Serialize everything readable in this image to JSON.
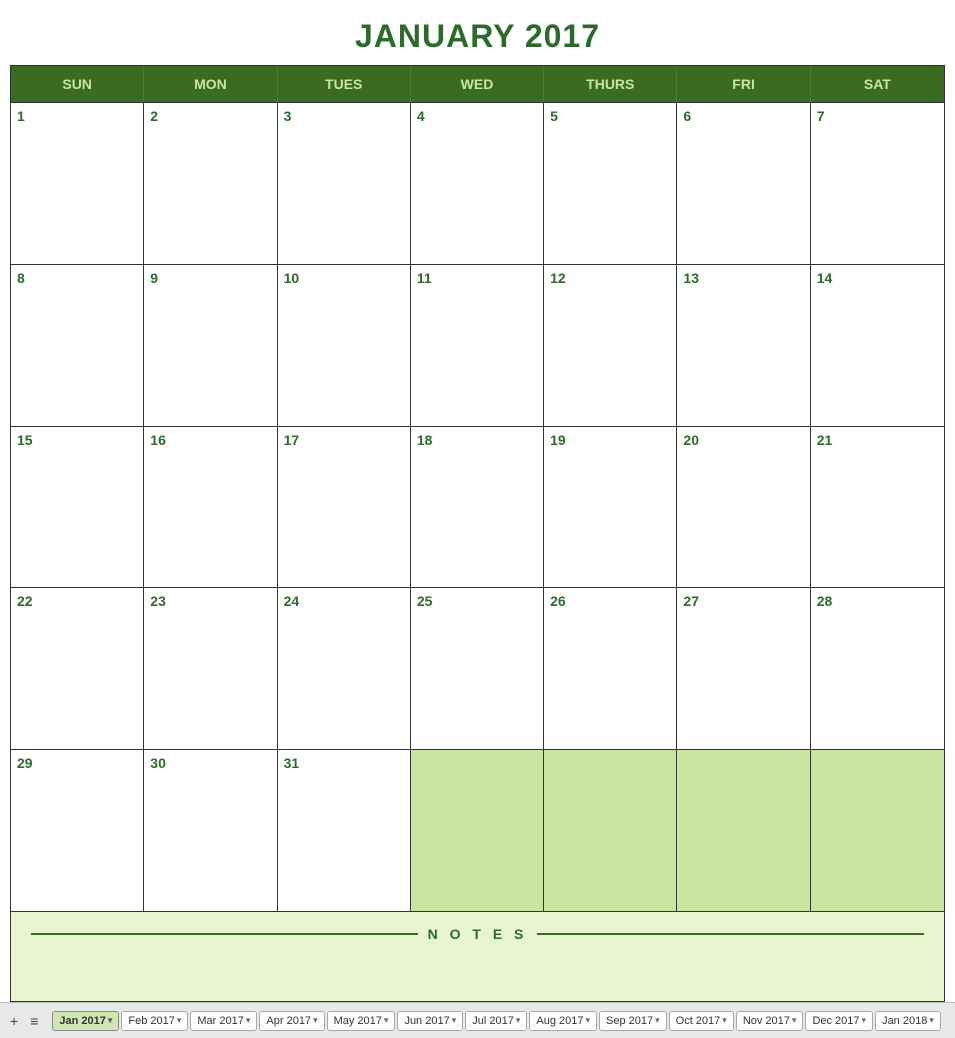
{
  "title": "JANUARY 2017",
  "days_of_week": [
    "SUN",
    "MON",
    "TUES",
    "WED",
    "THURS",
    "FRI",
    "SAT"
  ],
  "weeks": [
    [
      {
        "number": "1",
        "empty": false
      },
      {
        "number": "2",
        "empty": false
      },
      {
        "number": "3",
        "empty": false
      },
      {
        "number": "4",
        "empty": false
      },
      {
        "number": "5",
        "empty": false
      },
      {
        "number": "6",
        "empty": false
      },
      {
        "number": "7",
        "empty": false
      }
    ],
    [
      {
        "number": "8",
        "empty": false
      },
      {
        "number": "9",
        "empty": false
      },
      {
        "number": "10",
        "empty": false
      },
      {
        "number": "11",
        "empty": false
      },
      {
        "number": "12",
        "empty": false
      },
      {
        "number": "13",
        "empty": false
      },
      {
        "number": "14",
        "empty": false
      }
    ],
    [
      {
        "number": "15",
        "empty": false
      },
      {
        "number": "16",
        "empty": false
      },
      {
        "number": "17",
        "empty": false
      },
      {
        "number": "18",
        "empty": false
      },
      {
        "number": "19",
        "empty": false
      },
      {
        "number": "20",
        "empty": false
      },
      {
        "number": "21",
        "empty": false
      }
    ],
    [
      {
        "number": "22",
        "empty": false
      },
      {
        "number": "23",
        "empty": false
      },
      {
        "number": "24",
        "empty": false
      },
      {
        "number": "25",
        "empty": false
      },
      {
        "number": "26",
        "empty": false
      },
      {
        "number": "27",
        "empty": false
      },
      {
        "number": "28",
        "empty": false
      }
    ],
    [
      {
        "number": "29",
        "empty": false
      },
      {
        "number": "30",
        "empty": false
      },
      {
        "number": "31",
        "empty": false
      },
      {
        "number": "",
        "empty": true
      },
      {
        "number": "",
        "empty": true
      },
      {
        "number": "",
        "empty": true
      },
      {
        "number": "",
        "empty": true
      }
    ]
  ],
  "notes_label": "N O T E S",
  "tabs": [
    {
      "label": "Jan 2017",
      "active": true
    },
    {
      "label": "Feb 2017",
      "active": false
    },
    {
      "label": "Mar 2017",
      "active": false
    },
    {
      "label": "Apr 2017",
      "active": false
    },
    {
      "label": "May 2017",
      "active": false
    },
    {
      "label": "Jun 2017",
      "active": false
    },
    {
      "label": "Jul 2017",
      "active": false
    },
    {
      "label": "Aug 2017",
      "active": false
    },
    {
      "label": "Sep 2017",
      "active": false
    },
    {
      "label": "Oct 2017",
      "active": false
    },
    {
      "label": "Nov 2017",
      "active": false
    },
    {
      "label": "Dec 2017",
      "active": false
    },
    {
      "label": "Jan 2018",
      "active": false
    }
  ]
}
